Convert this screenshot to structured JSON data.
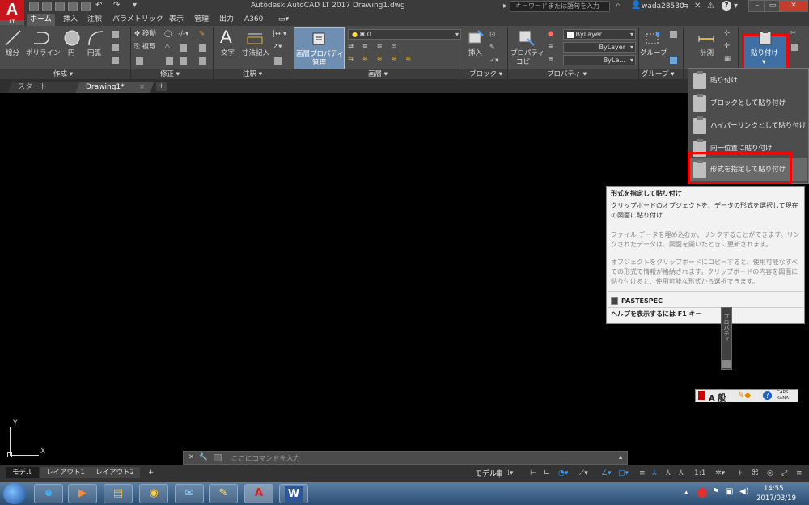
{
  "titlebar": {
    "app_logo": "A",
    "app_logo_sub": "LT",
    "title": "Autodesk AutoCAD LT 2017    Drawing1.dwg",
    "search_placeholder": "キーワードまたは語句を入力",
    "username": "wada28530"
  },
  "ribbon_tabs": [
    "ホーム",
    "挿入",
    "注釈",
    "パラメトリック",
    "表示",
    "管理",
    "出力",
    "A360"
  ],
  "ribbon": {
    "draw": {
      "line": "線分",
      "polyline": "ポリライン",
      "circle": "円",
      "arc": "円弧",
      "panel": "作成 ▾"
    },
    "modify": {
      "move": "移動",
      "copy": "複写",
      "panel": "修正 ▾"
    },
    "annotation": {
      "text": "文字",
      "dimension": "寸法記入",
      "panel": "注釈 ▾"
    },
    "layers": {
      "layer_properties_1": "画層プロパティ",
      "layer_properties_2": "管理",
      "layer_combo": "0",
      "panel": "画層 ▾"
    },
    "block": {
      "insert": "挿入",
      "panel": "ブロック ▾"
    },
    "properties": {
      "match_1": "プロパティ",
      "match_2": "コピー",
      "color": "ByLayer",
      "linetype": "ByLayer",
      "lineweight": "ByLa...",
      "panel": "プロパティ ▾"
    },
    "groups": {
      "group": "グループ",
      "panel": "グループ ▾"
    },
    "utilities": {
      "measure": "計測"
    },
    "clipboard": {
      "paste": "貼り付け",
      "paste_arrow": "▾"
    }
  },
  "doc_tabs": {
    "start": "スタート",
    "drawing": "Drawing1*",
    "close": "×",
    "add": "+"
  },
  "paste_menu": [
    "貼り付け",
    "ブロックとして貼り付け",
    "ハイパーリンクとして貼り付け",
    "同一位置に貼り付け",
    "形式を指定して貼り付け"
  ],
  "tooltip": {
    "title": "形式を指定して貼り付け",
    "desc": "クリップボードのオブジェクトを、データの形式を選択して現在の図面に貼り付け",
    "para1": "ファイル データを埋め込むか、リンクすることができます。リンクされたデータは、図面を開いたときに更新されます。",
    "para2": "オブジェクトをクリップボードにコピーすると、使用可能なすべての形式で情報が格納されます。クリップボードの内容を図面に貼り付けると、使用可能な形式から選択できます。",
    "command": "PASTESPEC",
    "help": "ヘルプを表示するには F1 キー"
  },
  "palette": {
    "properties": "プロパティ"
  },
  "langbar": {
    "ime": "A 般",
    "caps": "CAPS",
    "kana": "KANA"
  },
  "ucs": {
    "x": "X",
    "y": "Y"
  },
  "command_line": {
    "placeholder": "ここにコマンドを入力"
  },
  "layout_tabs": [
    "モデル",
    "レイアウト1",
    "レイアウト2",
    "+"
  ],
  "status": {
    "model": "モデル",
    "scale": "1:1"
  },
  "taskbar": {
    "time": "14:55",
    "date": "2017/03/19"
  },
  "colors": {
    "highlight": "#ff0000",
    "ribbon_bg": "#4c4c4c",
    "canvas": "#000000"
  }
}
